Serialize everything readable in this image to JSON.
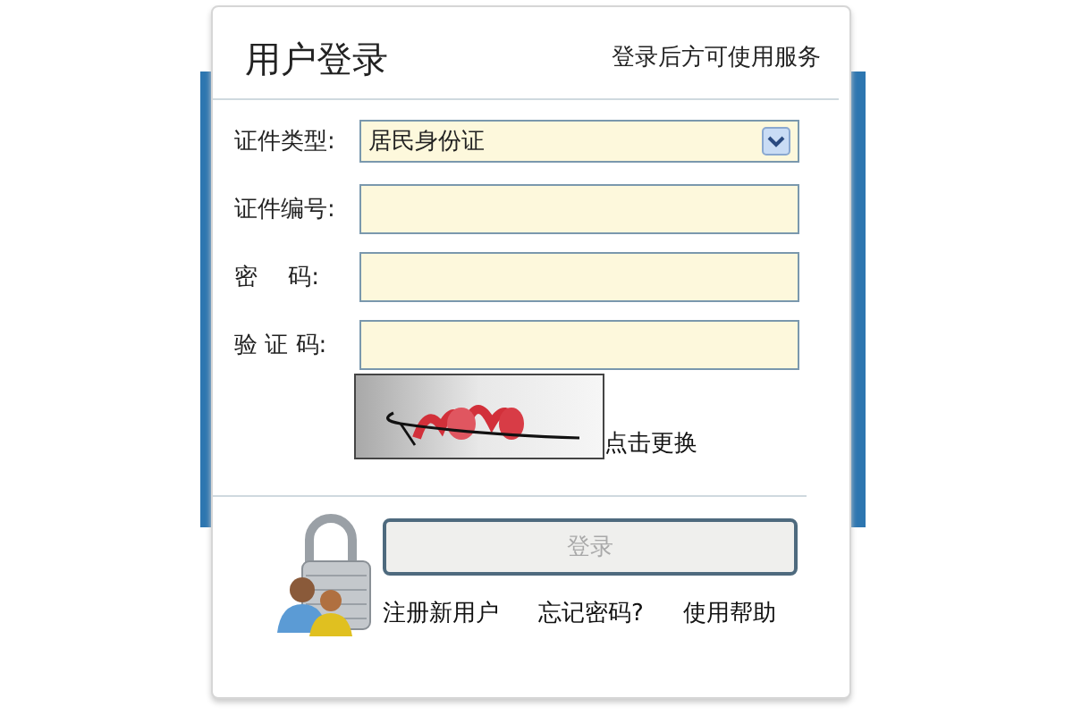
{
  "header": {
    "title": "用户登录",
    "note": "登录后方可使用服务"
  },
  "fields": [
    {
      "kind": "select",
      "label": "证件类型:",
      "value": "居民身份证"
    },
    {
      "kind": "text",
      "label": "证件编号:"
    },
    {
      "kind": "password",
      "label": "密　 码:"
    },
    {
      "kind": "text",
      "label": "验 证 码:"
    }
  ],
  "captcha": {
    "refresh_link": "点击更换"
  },
  "login_button": {
    "label": "登录",
    "disabled": true
  },
  "links": [
    "注册新用户",
    "忘记密码?",
    "使用帮助"
  ]
}
